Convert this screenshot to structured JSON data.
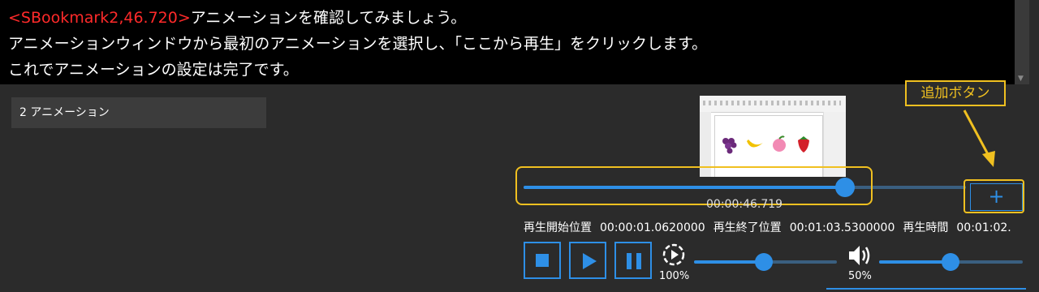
{
  "editor": {
    "bookmark_tag": "<SBookmark2,46.720>",
    "line1_text": "アニメーションを確認してみましょう。",
    "line2": "アニメーションウィンドウから最初のアニメーションを選択し、「ここから再生」をクリックします。",
    "line3": "これでアニメーションの設定は完了です。"
  },
  "tracks": [
    {
      "label": "2 アニメーション"
    }
  ],
  "callout": {
    "label": "追加ボタン"
  },
  "timeline": {
    "current_time": "00:00:46.719",
    "progress": 0.72
  },
  "add_button": {
    "label": "+"
  },
  "info": {
    "start_label": "再生開始位置",
    "start_value": "00:00:01.0620000",
    "end_label": "再生終了位置",
    "end_value": "00:01:03.5300000",
    "duration_label": "再生時間",
    "duration_value": "00:01:02."
  },
  "transport": {
    "stop_icon": "stop-icon",
    "play_icon": "play-icon",
    "pause_icon": "pause-icon"
  },
  "speed": {
    "label": "100%",
    "level": 0.5
  },
  "volume": {
    "label": "50%",
    "level": 0.5
  },
  "colors": {
    "accent": "#2e8fe6",
    "highlight": "#f0c020",
    "bookmark": "#ff2a2a",
    "background": "#2b2b2b"
  }
}
